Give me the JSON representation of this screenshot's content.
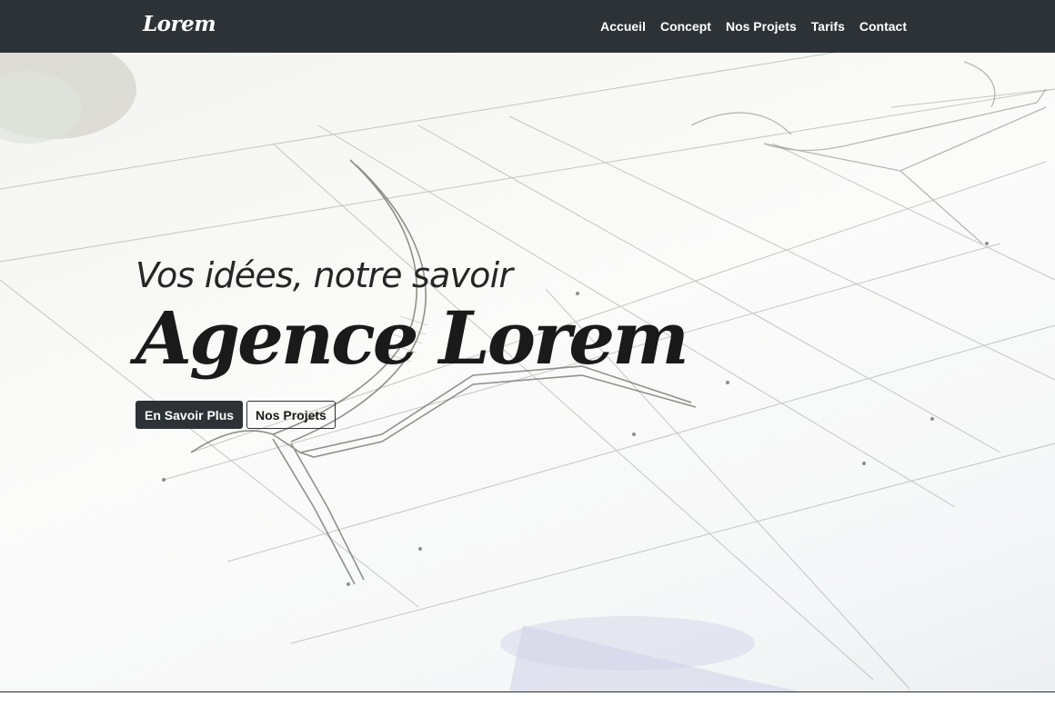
{
  "navbar": {
    "brand": "Lorem",
    "links": [
      "Accueil",
      "Concept",
      "Nos Projets",
      "Tarifs",
      "Contact"
    ]
  },
  "hero": {
    "tagline": "Vos idées, notre savoir",
    "title": "Agence Lorem",
    "buttons": {
      "primary": "En Savoir Plus",
      "secondary": "Nos Projets"
    },
    "background": "architectural-sketch-image"
  },
  "colors": {
    "navbar_bg": "#2d3236",
    "navbar_text": "#ffffff",
    "title_text": "#1a1a1a",
    "button_dark": "#2d3236"
  }
}
